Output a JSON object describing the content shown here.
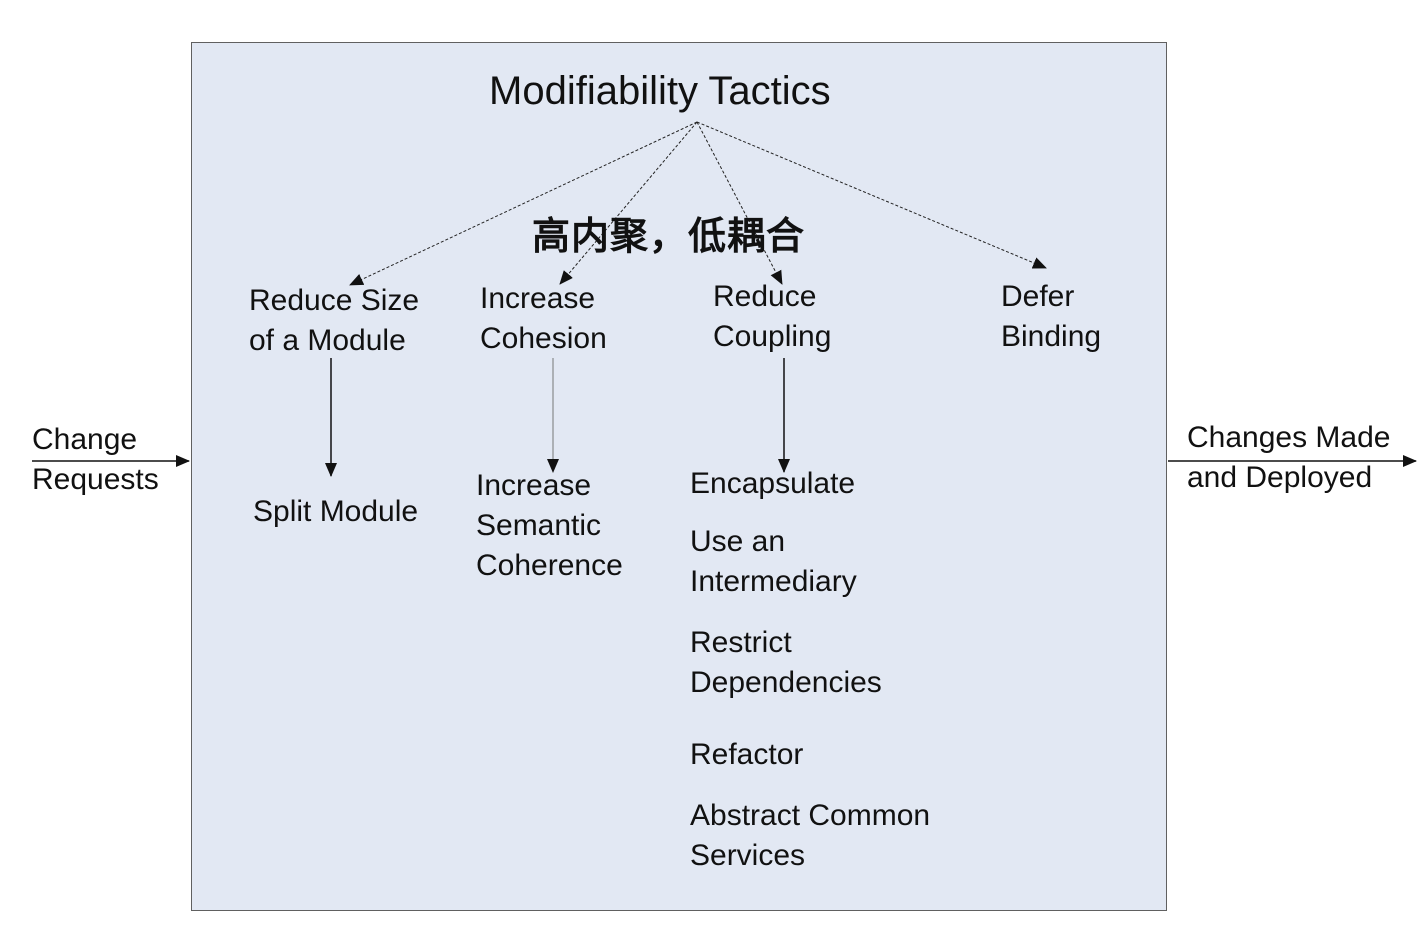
{
  "diagram": {
    "title": "Modifiability Tactics",
    "subtitle": "高内聚，低耦合",
    "input_label": "Change\nRequests",
    "output_label": "Changes Made\nand Deployed",
    "categories": [
      {
        "label": "Reduce Size\nof a Module"
      },
      {
        "label": "Increase\nCohesion"
      },
      {
        "label": "Reduce\nCoupling"
      },
      {
        "label": "Defer\nBinding"
      }
    ],
    "tactics": {
      "reduce_size": [
        "Split Module"
      ],
      "increase_cohesion": [
        "Increase\nSemantic\nCoherence"
      ],
      "reduce_coupling": [
        "Encapsulate",
        "Use an\nIntermediary",
        "Restrict\nDependencies",
        "Refactor",
        "Abstract Common\nServices"
      ]
    },
    "colors": {
      "box_fill": "#e2e8f3",
      "box_border": "#606060",
      "arrow": "#111111",
      "text": "#111111"
    }
  }
}
